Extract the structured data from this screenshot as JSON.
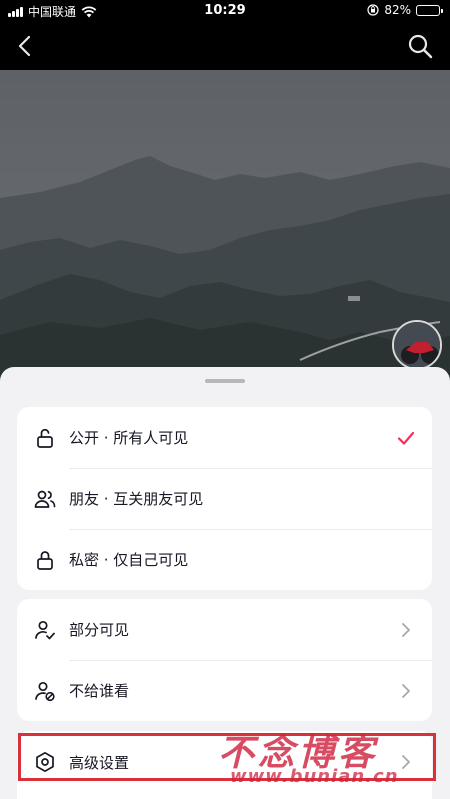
{
  "status_bar": {
    "carrier": "中国联通",
    "time": "10:29",
    "battery": "82%",
    "battery_level": 0.82
  },
  "nav": {
    "back_icon": "chevron-left-icon",
    "search_icon": "search-icon"
  },
  "sheet": {
    "visibility_options": [
      {
        "label": "公开 · 所有人可见",
        "icon": "unlock-icon",
        "selected": true
      },
      {
        "label": "朋友 · 互关朋友可见",
        "icon": "friends-icon",
        "selected": false
      },
      {
        "label": "私密 · 仅自己可见",
        "icon": "lock-icon",
        "selected": false
      }
    ],
    "partial_options": [
      {
        "label": "部分可见",
        "icon": "user-check-icon"
      },
      {
        "label": "不给谁看",
        "icon": "user-block-icon"
      }
    ],
    "advanced": {
      "label": "高级设置",
      "icon": "hexagon-settings-icon"
    }
  },
  "colors": {
    "accent": "#fe2c55",
    "highlight": "#d9303a",
    "sheet_bg": "#f2f2f4"
  },
  "watermark": {
    "title": "不念博客",
    "url": "www.bunian.cn"
  }
}
